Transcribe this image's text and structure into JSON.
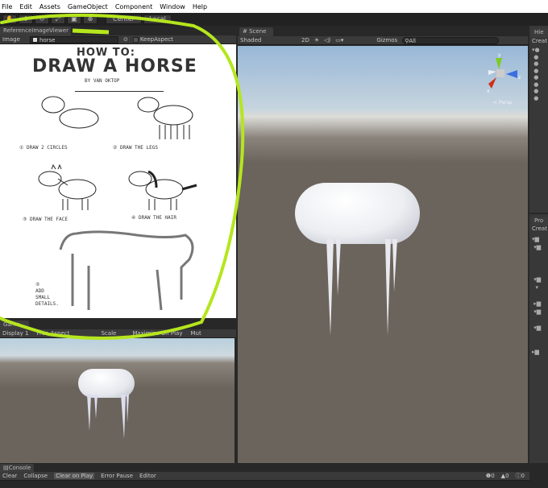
{
  "menu": [
    "File",
    "Edit",
    "Assets",
    "GameObject",
    "Component",
    "Window",
    "Help"
  ],
  "toolbar": {
    "tools": [
      "hand-icon",
      "move-icon",
      "rotate-icon",
      "scale-icon",
      "rect-icon",
      "transform-icon"
    ],
    "pivot": "Center",
    "space": "Local"
  },
  "ref_viewer": {
    "tab": "ReferenceImageViewer",
    "image_label": "Image",
    "image_value": "horse",
    "keep_aspect": "KeepAspect",
    "picture": {
      "title1": "HOW TO:",
      "title2": "DRAW A HORSE",
      "by": "BY   VAN OKTOP",
      "steps": [
        "① DRAW 2 CIRCLES",
        "② DRAW THE LEGS",
        "③ DRAW THE FACE",
        "④ DRAW THE HAIR"
      ],
      "step5": [
        "⑤",
        "ADD",
        "SMALL",
        "DETAILS."
      ]
    }
  },
  "game": {
    "tab": "Game",
    "display": "Display 1",
    "aspect": "Free Aspect",
    "scale": "Scale",
    "maximize": "Maximize On Play",
    "mute": "Mut"
  },
  "scene": {
    "tab": "Scene",
    "shading": "Shaded",
    "mode2d": "2D",
    "gizmos": "Gizmos",
    "search_placeholder": "All",
    "persp": "Persp",
    "axes": [
      "y",
      "z",
      "x"
    ]
  },
  "hierarchy": {
    "tab": "Hie",
    "create": "Creat"
  },
  "project": {
    "tab": "Pro",
    "create": "Creat"
  },
  "console": {
    "tab": "Console",
    "buttons": [
      "Clear",
      "Collapse",
      "Clear on Play",
      "Error Pause",
      "Editor"
    ],
    "counts": [
      "0",
      "0",
      "0"
    ]
  },
  "colors": {
    "scribble": "#b5e61d",
    "sky": "#a9c4dc",
    "ground": "#6b645c"
  }
}
